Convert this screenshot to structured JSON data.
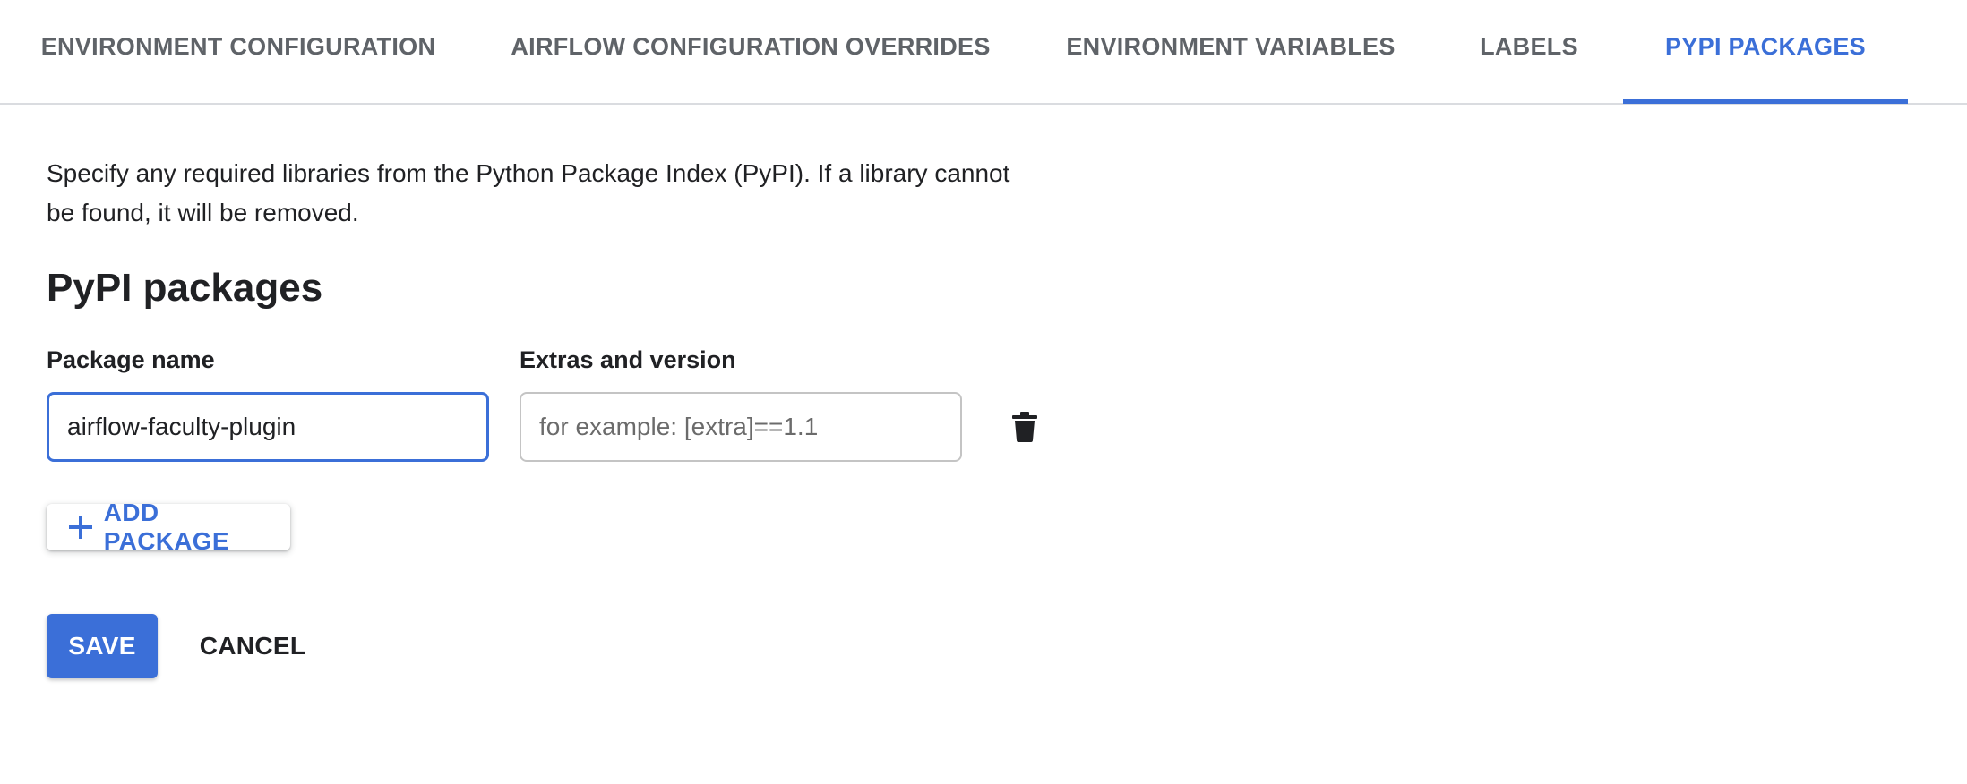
{
  "tabs": [
    {
      "label": "ENVIRONMENT CONFIGURATION",
      "active": false
    },
    {
      "label": "AIRFLOW CONFIGURATION OVERRIDES",
      "active": false
    },
    {
      "label": "ENVIRONMENT VARIABLES",
      "active": false
    },
    {
      "label": "LABELS",
      "active": false
    },
    {
      "label": "PYPI PACKAGES",
      "active": true
    }
  ],
  "description": "Specify any required libraries from the Python Package Index (PyPI). If a library cannot be found, it will be removed.",
  "section_title": "PyPI packages",
  "form": {
    "package_label": "Package name",
    "version_label": "Extras and version",
    "package_value": "airflow-faculty-plugin",
    "version_placeholder": "for example: [extra]==1.1",
    "version_value": ""
  },
  "add_button": {
    "label": "ADD PACKAGE",
    "icon": "plus-icon"
  },
  "delete_button": {
    "icon": "trash-icon"
  },
  "actions": {
    "save_label": "SAVE",
    "cancel_label": "CANCEL"
  },
  "colors": {
    "accent": "#3b6fd8",
    "tab_inactive": "#5f6368",
    "text": "#202124"
  }
}
